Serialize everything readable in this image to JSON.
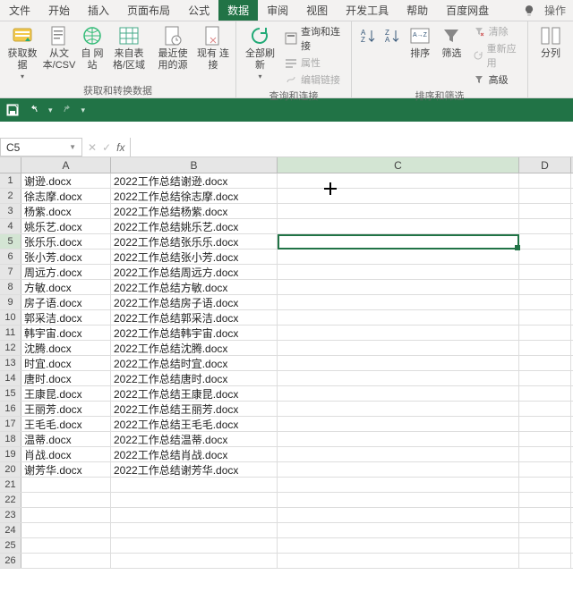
{
  "menu": {
    "tabs": [
      "文件",
      "开始",
      "插入",
      "页面布局",
      "公式",
      "数据",
      "审阅",
      "视图",
      "开发工具",
      "帮助",
      "百度网盘"
    ],
    "active_index": 5,
    "tell_me": "操作"
  },
  "ribbon": {
    "group_data": {
      "label": "获取和转换数据",
      "get_data": "获取数\n据",
      "from_text": "从文\n本/CSV",
      "from_web": "自\n网站",
      "from_table": "来自表\n格/区域",
      "recent": "最近使\n用的源",
      "existing": "现有\n连接"
    },
    "group_conn": {
      "label": "查询和连接",
      "refresh_all": "全部刷新",
      "queries": "查询和连接",
      "properties": "属性",
      "edit_links": "编辑链接"
    },
    "group_sort": {
      "label": "排序和筛选",
      "sort": "排序",
      "filter": "筛选",
      "clear": "清除",
      "reapply": "重新应用",
      "advanced": "高级"
    },
    "group_tools": {
      "columns": "分列"
    }
  },
  "namebox": {
    "value": "C5"
  },
  "columns": [
    "A",
    "B",
    "C",
    "D"
  ],
  "sheet": {
    "rows": [
      {
        "n": 1,
        "a": "谢逊.docx",
        "b": "2022工作总结谢逊.docx"
      },
      {
        "n": 2,
        "a": "徐志摩.docx",
        "b": "2022工作总结徐志摩.docx"
      },
      {
        "n": 3,
        "a": "杨紫.docx",
        "b": "2022工作总结杨紫.docx"
      },
      {
        "n": 4,
        "a": "姚乐艺.docx",
        "b": "2022工作总结姚乐艺.docx"
      },
      {
        "n": 5,
        "a": "张乐乐.docx",
        "b": "2022工作总结张乐乐.docx"
      },
      {
        "n": 6,
        "a": "张小芳.docx",
        "b": "2022工作总结张小芳.docx"
      },
      {
        "n": 7,
        "a": "周远方.docx",
        "b": "2022工作总结周远方.docx"
      },
      {
        "n": 8,
        "a": "方敏.docx",
        "b": "2022工作总结方敏.docx"
      },
      {
        "n": 9,
        "a": "房子语.docx",
        "b": "2022工作总结房子语.docx"
      },
      {
        "n": 10,
        "a": "郭采洁.docx",
        "b": "2022工作总结郭采洁.docx"
      },
      {
        "n": 11,
        "a": "韩宇宙.docx",
        "b": "2022工作总结韩宇宙.docx"
      },
      {
        "n": 12,
        "a": "沈腾.docx",
        "b": "2022工作总结沈腾.docx"
      },
      {
        "n": 13,
        "a": "时宜.docx",
        "b": "2022工作总结时宜.docx"
      },
      {
        "n": 14,
        "a": "唐时.docx",
        "b": "2022工作总结唐时.docx"
      },
      {
        "n": 15,
        "a": "王康昆.docx",
        "b": "2022工作总结王康昆.docx"
      },
      {
        "n": 16,
        "a": "王丽芳.docx",
        "b": "2022工作总结王丽芳.docx"
      },
      {
        "n": 17,
        "a": "王毛毛.docx",
        "b": "2022工作总结王毛毛.docx"
      },
      {
        "n": 18,
        "a": "温蒂.docx",
        "b": "2022工作总结温蒂.docx"
      },
      {
        "n": 19,
        "a": "肖战.docx",
        "b": "2022工作总结肖战.docx"
      },
      {
        "n": 20,
        "a": "谢芳华.docx",
        "b": "2022工作总结谢芳华.docx"
      },
      {
        "n": 21,
        "a": "",
        "b": ""
      },
      {
        "n": 22,
        "a": "",
        "b": ""
      },
      {
        "n": 23,
        "a": "",
        "b": ""
      },
      {
        "n": 24,
        "a": "",
        "b": ""
      },
      {
        "n": 25,
        "a": "",
        "b": ""
      },
      {
        "n": 26,
        "a": "",
        "b": ""
      }
    ]
  },
  "selection": {
    "col": "C",
    "row": 5
  }
}
